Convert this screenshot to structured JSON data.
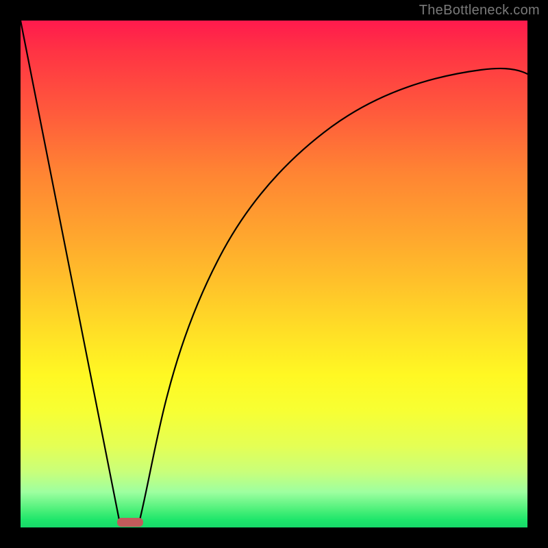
{
  "watermark": "TheBottleneck.com",
  "chart_data": {
    "type": "line",
    "title": "",
    "xlabel": "",
    "ylabel": "",
    "xlim": [
      0,
      1
    ],
    "ylim": [
      0,
      1
    ],
    "background_gradient": {
      "top": "#ff1a4d",
      "bottom": "#17d96a",
      "description": "vertical red-to-green spectrum"
    },
    "series": [
      {
        "name": "left-descending-line",
        "type": "line",
        "x": [
          0.0,
          0.195
        ],
        "y": [
          1.0,
          0.015
        ]
      },
      {
        "name": "right-ascending-curve",
        "type": "line",
        "x": [
          0.235,
          0.26,
          0.29,
          0.33,
          0.38,
          0.44,
          0.51,
          0.59,
          0.68,
          0.78,
          0.89,
          1.0
        ],
        "y": [
          0.015,
          0.11,
          0.23,
          0.36,
          0.48,
          0.58,
          0.67,
          0.74,
          0.8,
          0.845,
          0.875,
          0.895
        ]
      }
    ],
    "marker": {
      "name": "valley-marker",
      "shape": "rounded-rect",
      "x_range": [
        0.195,
        0.235
      ],
      "y": 0.0,
      "color": "#c15b5b"
    }
  }
}
